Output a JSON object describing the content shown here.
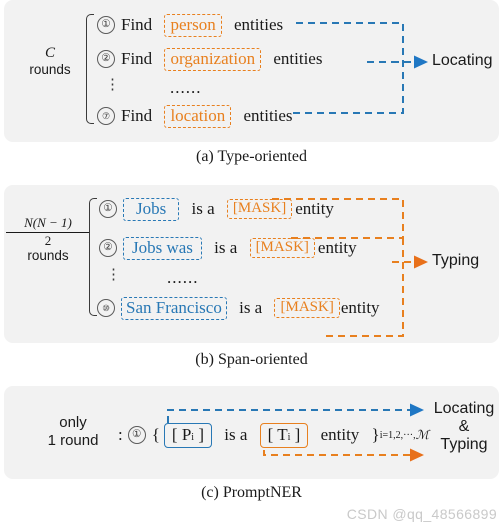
{
  "figure": {
    "watermark": "CSDN @qq_48566899"
  },
  "panels": [
    {
      "id": "a",
      "caption": "(a) Type-oriented",
      "rounds_symbol": "C",
      "rounds_word": "rounds",
      "ellipsis": "......",
      "vdots": "⋮",
      "target": "Locating",
      "rows": [
        {
          "index": "①",
          "verb": "Find",
          "tag": "person",
          "tail": "entities"
        },
        {
          "index": "②",
          "verb": "Find",
          "tag": "organization",
          "tail": "entities"
        },
        {
          "index": "⑦",
          "verb": "Find",
          "tag": "location",
          "tail": "entities"
        }
      ]
    },
    {
      "id": "b",
      "caption": "(b) Span-oriented",
      "frac_numerator": "N(N − 1)",
      "frac_denominator": "2",
      "rounds_word": "rounds",
      "ellipsis": "......",
      "vdots": "⋮",
      "target": "Typing",
      "rows": [
        {
          "index": "①",
          "span": "Jobs",
          "mid": "is a",
          "mask": "[MASK]",
          "tail": "entity"
        },
        {
          "index": "②",
          "span": "Jobs was",
          "mid": "is a",
          "mask": "[MASK]",
          "tail": "entity"
        },
        {
          "index": "⑩",
          "span": "San Francisco",
          "mid": "is a",
          "mask": "[MASK]",
          "tail": "entity"
        }
      ]
    },
    {
      "id": "c",
      "caption": "(c) PromptNER",
      "rounds_line1": "only",
      "rounds_line2": "1 round",
      "colon": ":",
      "index": "①",
      "brace_open": "{",
      "span_token": "[ P",
      "span_sub": "i",
      "span_close": " ]",
      "mid": "is a",
      "type_token": "[ T",
      "type_sub": "i",
      "type_close": " ]",
      "tail": "entity",
      "brace_close": "}",
      "subscript": "i=1,2,···,",
      "subscript_cal": "ℳ",
      "target_line1": "Locating",
      "target_line2": "&",
      "target_line3": "Typing"
    }
  ],
  "colors": {
    "blue": "#2878b5",
    "orange": "#e8801f",
    "panel_bg": "#f2f2f2",
    "text": "#1a1a1a",
    "watermark": "#c9c9c9"
  }
}
